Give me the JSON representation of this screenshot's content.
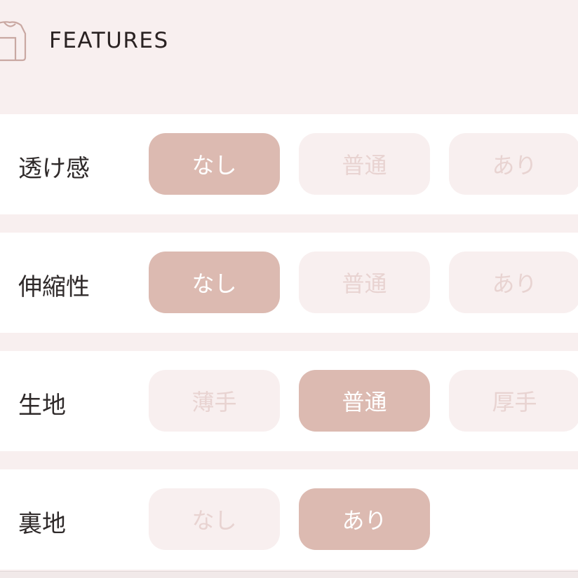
{
  "header": {
    "title": "FEATURES",
    "icon": "shirt-icon"
  },
  "colors": {
    "page_background": "#f8efef",
    "row_background": "#ffffff",
    "selected_background": "#dcbab1",
    "selected_text": "#ffffff",
    "unselected_background": "#f8efef",
    "unselected_text": "#e8d3d1",
    "label_text": "#2f2a2a"
  },
  "features": [
    {
      "label": "透け感",
      "options": [
        {
          "label": "なし",
          "selected": true
        },
        {
          "label": "普通",
          "selected": false
        },
        {
          "label": "あり",
          "selected": false
        }
      ]
    },
    {
      "label": "伸縮性",
      "options": [
        {
          "label": "なし",
          "selected": true
        },
        {
          "label": "普通",
          "selected": false
        },
        {
          "label": "あり",
          "selected": false
        }
      ]
    },
    {
      "label": "生地",
      "options": [
        {
          "label": "薄手",
          "selected": false
        },
        {
          "label": "普通",
          "selected": true
        },
        {
          "label": "厚手",
          "selected": false
        }
      ]
    },
    {
      "label": "裏地",
      "options": [
        {
          "label": "なし",
          "selected": false
        },
        {
          "label": "あり",
          "selected": true
        }
      ]
    }
  ]
}
